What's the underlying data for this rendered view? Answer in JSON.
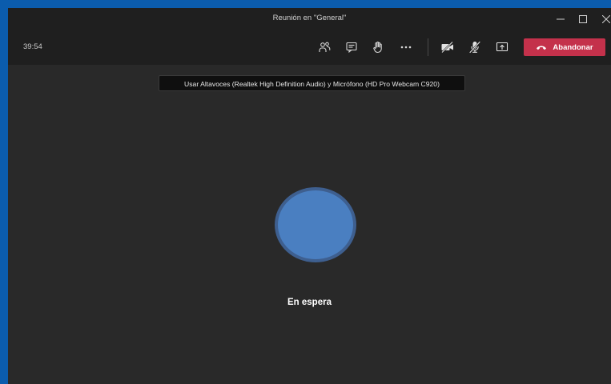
{
  "window": {
    "title": "Reunión en \"General\""
  },
  "toolbar": {
    "timer": "39:54",
    "leave_label": "Abandonar"
  },
  "tooltip": {
    "text": "Usar Altavoces (Realtek High Definition Audio) y Micrófono (HD Pro Webcam C920)"
  },
  "participant": {
    "status": "En espera"
  },
  "icons": {
    "participants": "people-icon",
    "chat": "chat-icon",
    "raise_hand": "hand-icon",
    "more": "more-options-icon",
    "camera": "camera-off-icon",
    "mic": "mic-off-icon",
    "share": "share-screen-icon",
    "leave": "phone-hangup-icon"
  },
  "colors": {
    "leave_button": "#c4314b",
    "avatar": "#4a7fc1",
    "background": "#292929"
  }
}
